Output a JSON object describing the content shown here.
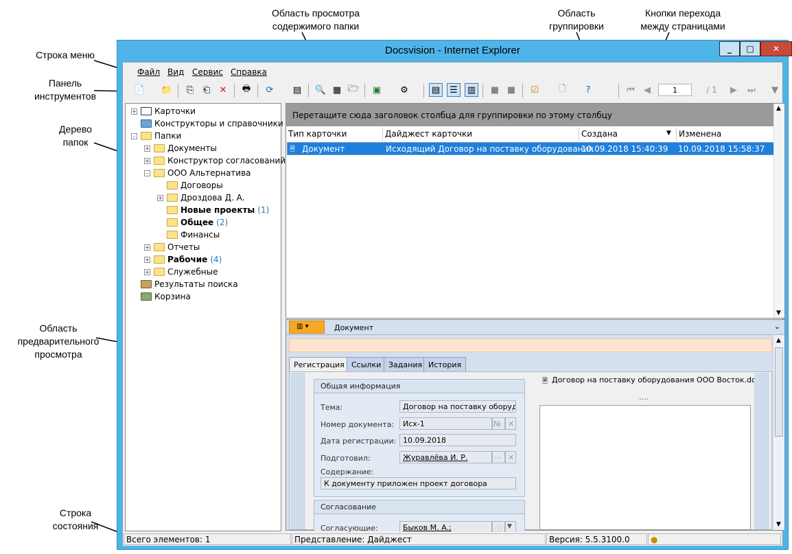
{
  "annotations": {
    "menu_row": "Строка меню",
    "toolbar": "Панель\nинструментов",
    "tree": "Дерево\nпапок",
    "folder_view": "Область просмотра\nсодержимого папки",
    "grouping": "Область\nгруппировки",
    "paging": "Кнопки перехода\nмежду страницами",
    "preview": "Область\nпредварительного\nпросмотра",
    "statusbar": "Строка\nсостояния"
  },
  "window": {
    "title": "Docsvision - Internet Explorer"
  },
  "menu": [
    "Файл",
    "Вид",
    "Сервис",
    "Справка"
  ],
  "paging": {
    "page": "1",
    "total": "/ 1"
  },
  "tree": [
    {
      "label": "Карточки",
      "level": 0,
      "expander": "+",
      "icon": "cards-icon"
    },
    {
      "label": "Конструкторы и справочники",
      "level": 0,
      "expander": "",
      "icon": "book-icon"
    },
    {
      "label": "Папки",
      "level": 0,
      "expander": "-",
      "icon": "folder-icon"
    },
    {
      "label": "Документы",
      "level": 1,
      "expander": "+",
      "icon": "folder-icon"
    },
    {
      "label": "Конструктор согласований",
      "level": 1,
      "expander": "+",
      "icon": "folder-icon"
    },
    {
      "label": "ООО Альтернатива",
      "level": 1,
      "expander": "-",
      "icon": "folder-icon"
    },
    {
      "label": "Договоры",
      "level": 2,
      "expander": "",
      "icon": "open-folder-icon"
    },
    {
      "label": "Дроздова Д. А.",
      "level": 2,
      "expander": "+",
      "icon": "folder-icon"
    },
    {
      "label": "Новые проекты",
      "level": 2,
      "expander": "",
      "icon": "folder-icon",
      "bold": true,
      "count": "(1)"
    },
    {
      "label": "Общее",
      "level": 2,
      "expander": "",
      "icon": "folder-icon",
      "bold": true,
      "count": "(2)"
    },
    {
      "label": "Финансы",
      "level": 2,
      "expander": "",
      "icon": "folder-icon"
    },
    {
      "label": "Отчеты",
      "level": 1,
      "expander": "+",
      "icon": "folder-icon"
    },
    {
      "label": "Рабочие",
      "level": 1,
      "expander": "+",
      "icon": "folder-icon",
      "bold": true,
      "count": "(4)"
    },
    {
      "label": "Служебные",
      "level": 1,
      "expander": "+",
      "icon": "folder-icon"
    },
    {
      "label": "Результаты поиска",
      "level": 0,
      "expander": "",
      "icon": "search-results-icon"
    },
    {
      "label": "Корзина",
      "level": 0,
      "expander": "",
      "icon": "trash-icon"
    }
  ],
  "grid": {
    "group_hint": "Перетащите сюда заголовок столбца для группировки по этому столбцу",
    "columns": [
      "Тип карточки",
      "Дайджест карточки",
      "Создана",
      "Изменена"
    ],
    "rows": [
      {
        "type": "Документ",
        "digest": "Исходящий Договор на поставку оборудования",
        "created": "10.09.2018 15:40:39",
        "modified": "10.09.2018 15:58:37"
      }
    ]
  },
  "preview": {
    "caption": "Документ",
    "tabs": [
      "Регистрация",
      "Ссылки",
      "Задания",
      "История"
    ],
    "general_group": "Общая информация",
    "fields": {
      "topic_label": "Тема:",
      "topic_value": "Договор на поставку оборудова",
      "number_label": "Номер документа:",
      "number_value": "Исх-1",
      "number_btn": "№",
      "date_label": "Дата регистрации:",
      "date_value": "10.09.2018",
      "prepared_label": "Подготовил:",
      "prepared_value": "Журавлёва И. Р.",
      "content_label": "Содержание:",
      "content_value": "К документу приложен проект договора"
    },
    "approval_group": "Согласование",
    "approvers_label": "Согласующие:",
    "approvers_value": "Быков М. А.;",
    "file_name": "Договор на поставку оборудования ООО Восток.docx",
    "file_more": "...."
  },
  "status": {
    "count": "Всего элементов: 1",
    "view": "Представление: Дайджест",
    "version": "Версия: 5.5.3100.0"
  }
}
